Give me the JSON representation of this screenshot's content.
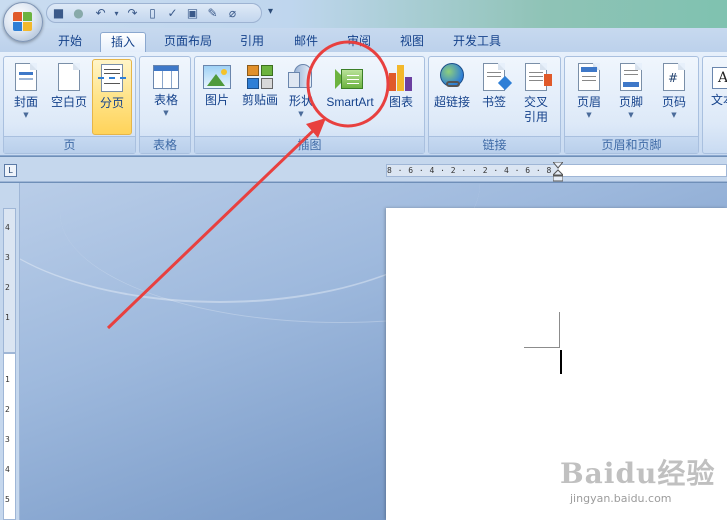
{
  "quick_access": {
    "items": [
      "save-icon",
      "undo-icon",
      "undo-dropdown-icon",
      "redo-icon",
      "print-preview-icon",
      "spelling-icon",
      "document-icon",
      "insert-icon",
      "link-icon",
      "customize-icon"
    ]
  },
  "tabs": [
    {
      "label": "开始"
    },
    {
      "label": "插入"
    },
    {
      "label": "页面布局"
    },
    {
      "label": "引用"
    },
    {
      "label": "邮件"
    },
    {
      "label": "审阅"
    },
    {
      "label": "视图"
    },
    {
      "label": "开发工具"
    }
  ],
  "ribbon": {
    "groups": [
      {
        "label": "页",
        "buttons": [
          {
            "label": "封面",
            "icon": "cover-page-icon"
          },
          {
            "label": "空白页",
            "icon": "blank-page-icon"
          },
          {
            "label": "分页",
            "icon": "page-break-icon"
          }
        ]
      },
      {
        "label": "表格",
        "buttons": [
          {
            "label": "表格",
            "icon": "table-icon"
          }
        ]
      },
      {
        "label": "插图",
        "buttons": [
          {
            "label": "图片",
            "icon": "picture-icon"
          },
          {
            "label": "剪贴画",
            "icon": "clip-art-icon"
          },
          {
            "label": "形状",
            "icon": "shapes-icon"
          },
          {
            "label": "SmartArt",
            "icon": "smartart-icon"
          },
          {
            "label": "图表",
            "icon": "chart-icon"
          }
        ]
      },
      {
        "label": "链接",
        "buttons": [
          {
            "label": "超链接",
            "icon": "hyperlink-icon"
          },
          {
            "label": "书签",
            "icon": "bookmark-icon"
          },
          {
            "label": "交叉",
            "label2": "引用",
            "icon": "cross-reference-icon"
          }
        ]
      },
      {
        "label": "页眉和页脚",
        "buttons": [
          {
            "label": "页眉",
            "icon": "header-icon"
          },
          {
            "label": "页脚",
            "icon": "footer-icon"
          },
          {
            "label": "页码",
            "icon": "page-number-icon"
          }
        ]
      },
      {
        "label": "",
        "buttons": [
          {
            "label": "文本",
            "icon": "text-box-icon"
          }
        ]
      }
    ]
  },
  "hruler": {
    "ticks": "8 · 6 · 4 · 2 ·   · 2 · 4 · 6 · 8"
  },
  "vruler": {
    "numbers": [
      "4",
      "3",
      "2",
      "1",
      "1",
      "2",
      "3",
      "4",
      "5"
    ]
  },
  "watermark": {
    "brand": "Baidu经验",
    "url": "jingyan.baidu.com"
  },
  "colors": {
    "ribbon": "#dde9f8",
    "tab_text": "#15428b",
    "highlight": "#ffe48a",
    "annotation": "#e8403f"
  }
}
